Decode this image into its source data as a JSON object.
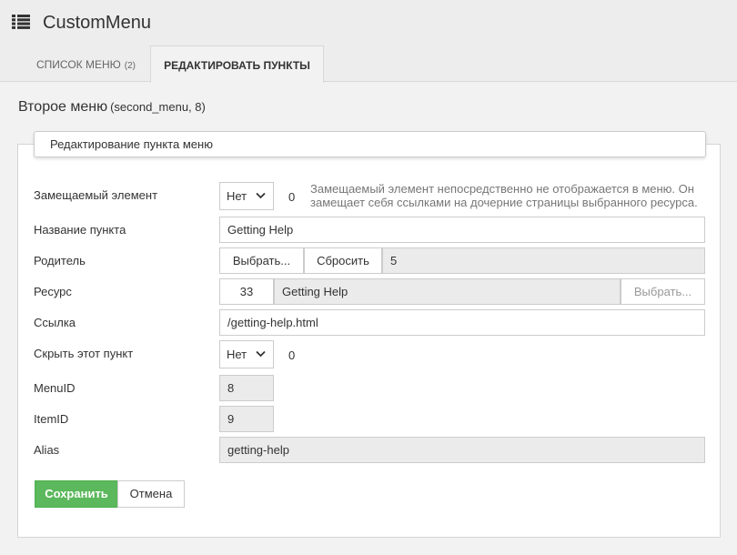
{
  "header": {
    "title": "CustomMenu",
    "icon": "list-icon"
  },
  "tabs": [
    {
      "label": "Список меню",
      "count": "(2)",
      "active": false
    },
    {
      "label": "Редактировать пункты",
      "active": true
    }
  ],
  "page": {
    "title": "Второе меню",
    "subtitle": "(second_menu, 8)"
  },
  "form": {
    "legend": "Редактирование пункта меню",
    "replaced": {
      "label": "Замещаемый элемент",
      "value": "Нет",
      "extra": "0",
      "hint": "Замещаемый элемент непосредственно не отображается в меню. Он замещает себя ссылками на дочерние страницы выбранного ресурса."
    },
    "title": {
      "label": "Название пункта",
      "value": "Getting Help"
    },
    "parent": {
      "label": "Родитель",
      "choose_label": "Выбрать...",
      "reset_label": "Сбросить",
      "value": "5"
    },
    "resource": {
      "label": "Ресурс",
      "id": "33",
      "name": "Getting Help",
      "choose_label": "Выбрать..."
    },
    "link": {
      "label": "Ссылка",
      "value": "/getting-help.html"
    },
    "hide": {
      "label": "Скрыть этот пункт",
      "value": "Нет",
      "extra": "0"
    },
    "menuid": {
      "label": "MenuID",
      "value": "8"
    },
    "itemid": {
      "label": "ItemID",
      "value": "9"
    },
    "alias": {
      "label": "Alias",
      "value": "getting-help"
    }
  },
  "actions": {
    "save_label": "Сохранить",
    "cancel_label": "Отмена"
  },
  "colors": {
    "save_button": "#5cb85c",
    "readonly_bg": "#ebebeb",
    "page_bg": "#f2f2f2"
  }
}
